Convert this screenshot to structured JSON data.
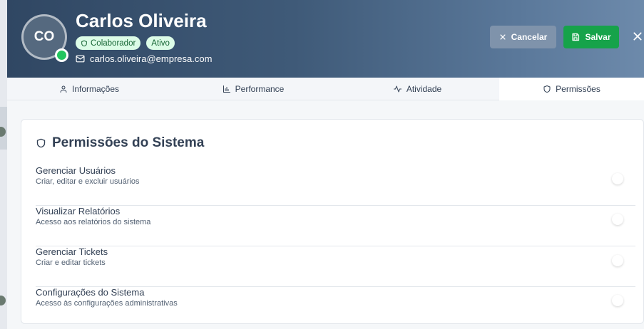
{
  "user": {
    "initials": "CO",
    "name": "Carlos Oliveira",
    "role": "Colaborador",
    "status": "Ativo",
    "email": "carlos.oliveira@empresa.com"
  },
  "actions": {
    "cancel_label": "Cancelar",
    "save_label": "Salvar"
  },
  "tabs": [
    {
      "label": "Informações",
      "icon": "user-icon"
    },
    {
      "label": "Performance",
      "icon": "bar-chart-icon"
    },
    {
      "label": "Atividade",
      "icon": "activity-icon"
    },
    {
      "label": "Permissões",
      "icon": "shield-icon",
      "active": true
    }
  ],
  "permissions": {
    "title": "Permissões do Sistema",
    "items": [
      {
        "name": "Gerenciar Usuários",
        "description": "Criar, editar e excluir usuários",
        "enabled": false
      },
      {
        "name": "Visualizar Relatórios",
        "description": "Acesso aos relatórios do sistema",
        "enabled": false
      },
      {
        "name": "Gerenciar Tickets",
        "description": "Criar e editar tickets",
        "enabled": false
      },
      {
        "name": "Configurações do Sistema",
        "description": "Acesso às configurações administrativas",
        "enabled": false
      }
    ]
  },
  "colors": {
    "header_start": "#304763",
    "header_end": "#6d8aab",
    "save_button": "#16a34a",
    "cancel_button": "#7f93ab",
    "online": "#22c55e"
  }
}
